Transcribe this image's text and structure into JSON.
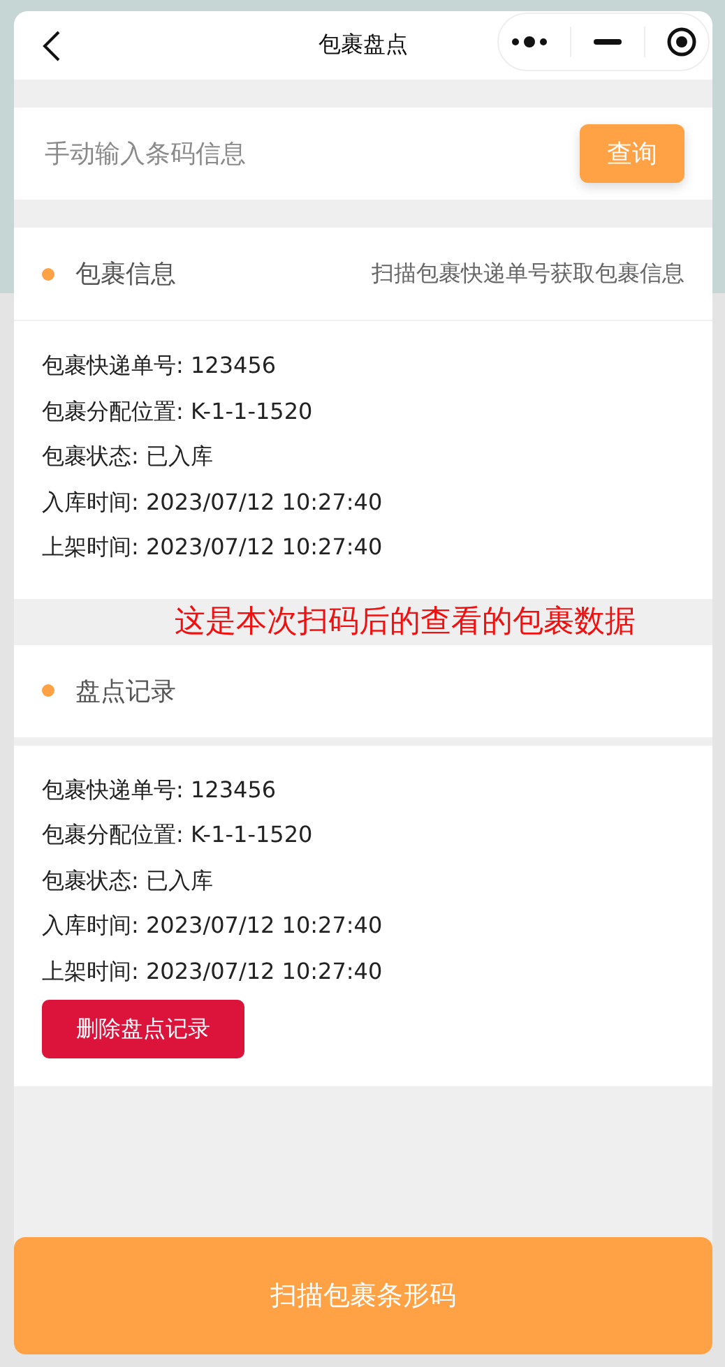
{
  "nav": {
    "title": "包裹盘点"
  },
  "search": {
    "placeholder": "手动输入条码信息",
    "button": "查询"
  },
  "package_info": {
    "title": "包裹信息",
    "hint": "扫描包裹快递单号获取包裹信息",
    "lines": [
      "包裹快递单号: 123456",
      "包裹分配位置: K-1-1-1520",
      "包裹状态: 已入库",
      "入库时间: 2023/07/12 10:27:40",
      "上架时间: 2023/07/12 10:27:40"
    ]
  },
  "annotation": "这是本次扫码后的查看的包裹数据",
  "records": {
    "title": "盘点记录",
    "lines": [
      "包裹快递单号: 123456",
      "包裹分配位置: K-1-1-1520",
      "包裹状态: 已入库",
      "入库时间: 2023/07/12 10:27:40",
      "上架时间: 2023/07/12 10:27:40"
    ],
    "delete_button": "删除盘点记录"
  },
  "scan_button": "扫描包裹条形码"
}
